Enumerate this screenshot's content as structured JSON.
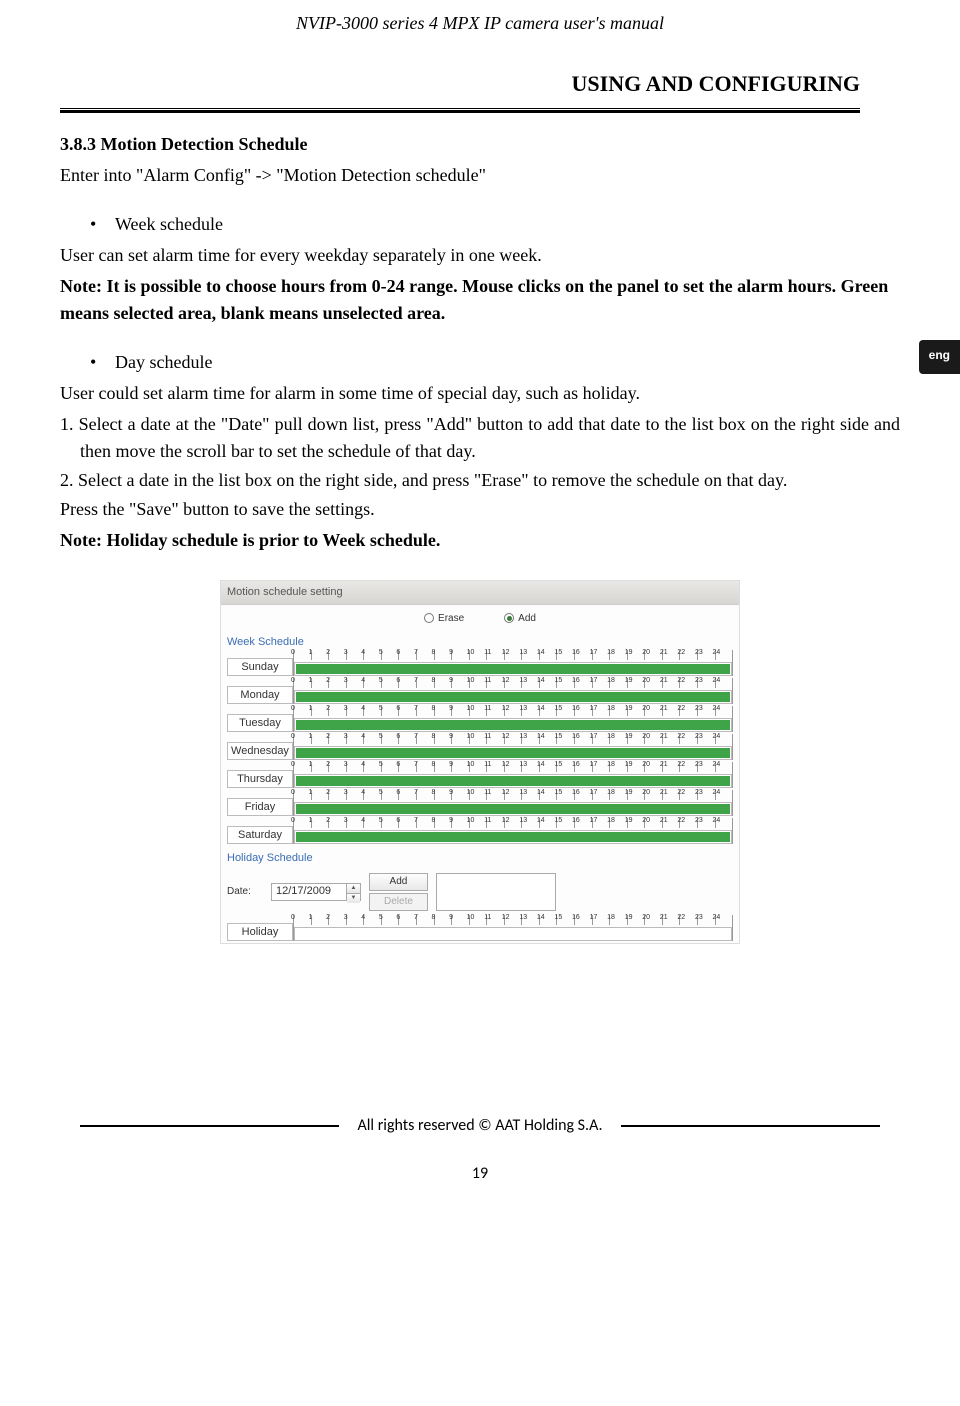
{
  "header": {
    "doc_title": "NVIP-3000 series 4 MPX IP camera user's manual",
    "section_title": "USING AND CONFIGURING"
  },
  "lang_tab": "eng",
  "content": {
    "subsection": "3.8.3 Motion Detection Schedule",
    "intro": "Enter into \"Alarm Config\" ->  \"Motion Detection schedule\"",
    "bullet_week": "Week schedule",
    "week_desc": "User can set alarm time for every weekday separately in one week.",
    "week_note": "Note: It is possible to choose hours from 0-24 range. Mouse clicks on the panel to set the alarm hours. Green means selected area, blank means unselected area.",
    "bullet_day": "Day schedule",
    "day_desc": "User could set alarm time for alarm in some time of special day, such as holiday.",
    "step1": "1. Select a date at the \"Date\" pull down list, press \"Add\" button to add that date to the list box on the right side and then move the scroll bar to set the schedule of that day.",
    "step2": "2. Select a date in the list box on the right side, and press \"Erase\" to remove the schedule on that day.",
    "save_text": "Press the \"Save\" button to save the settings.",
    "priority_note": "Note: Holiday schedule is prior to Week schedule."
  },
  "panel": {
    "title": "Motion schedule setting",
    "erase_label": "Erase",
    "add_label": "Add",
    "week_group": "Week Schedule",
    "holiday_group": "Holiday Schedule",
    "date_label": "Date:",
    "date_value": "12/17/2009",
    "add_btn": "Add",
    "delete_btn": "Delete",
    "holiday_row_label": "Holiday",
    "hours": [
      "0",
      "1",
      "2",
      "3",
      "4",
      "5",
      "6",
      "7",
      "8",
      "9",
      "10",
      "11",
      "12",
      "13",
      "14",
      "15",
      "16",
      "17",
      "18",
      "19",
      "20",
      "21",
      "22",
      "23",
      "24"
    ],
    "days": [
      "Sunday",
      "Monday",
      "Tuesday",
      "Wednesday",
      "Thursday",
      "Friday",
      "Saturday"
    ]
  },
  "footer": {
    "rights": "All rights reserved © AAT Holding S.A.",
    "page_number": "19"
  }
}
